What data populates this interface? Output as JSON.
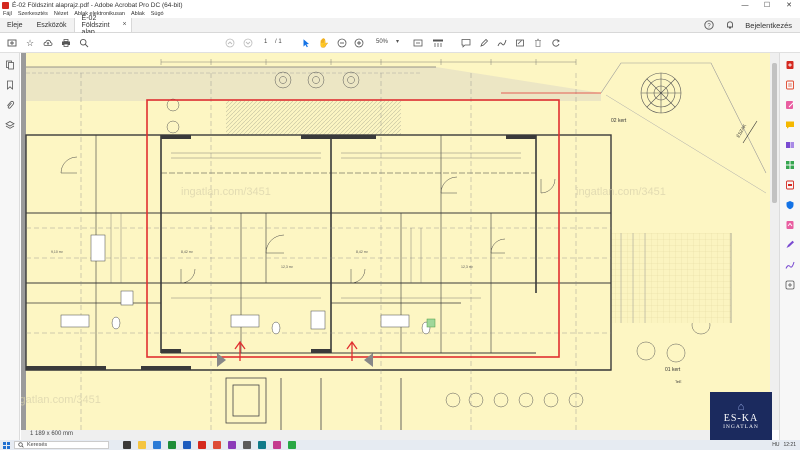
{
  "window": {
    "title": "É-02 Földszint alaprajz.pdf - Adobe Acrobat Pro DC (64-bit)",
    "minimize": "—",
    "maximize": "☐",
    "close": "✕"
  },
  "menu": [
    "Fájl",
    "Szerkesztés",
    "Nézet",
    "Ablak elektronikusan",
    "Ablak",
    "Súgó"
  ],
  "tabs": {
    "home": "Eleje",
    "tools": "Eszközök",
    "document": "É-02 Földszint alap...",
    "close": "×"
  },
  "header": {
    "sign_in": "Bejelentkezés"
  },
  "toolbar": {
    "page_current": "1",
    "page_total": "/ 1",
    "zoom": "50%"
  },
  "plan": {
    "top_label": "02 kert",
    "bottom_label": "01 kert",
    "north": "ÉSZAK",
    "watermark": "ingatlan.com/3451",
    "dim_label": "1 189 x 600 mm",
    "room_code": "TeE"
  },
  "status": {
    "page_size": "1 189 x 600 mm"
  },
  "taskbar": {
    "search_label": "Keresés",
    "clock": "12:21",
    "lang": "HU"
  },
  "logo": {
    "line1": "ES-KA",
    "line2": "INGATLAN"
  },
  "colors": {
    "plan_paper": "#fdf6c3",
    "selection_red": "#e03030",
    "acrobat_red": "#d4281f",
    "logo_blue": "#1b2a5e"
  }
}
